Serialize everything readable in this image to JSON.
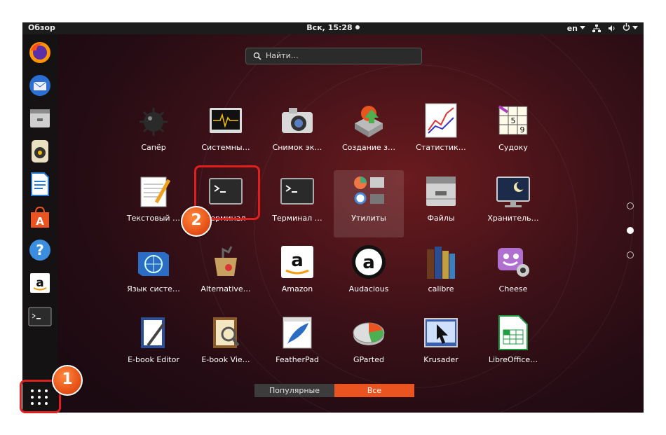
{
  "topbar": {
    "activities": "Обзор",
    "clock": "Вск, 15:28",
    "lang": "en"
  },
  "search": {
    "placeholder": "Найти…"
  },
  "dock": [
    "firefox-icon",
    "thunderbird-icon",
    "files-icon",
    "rhythmbox-icon",
    "writer-icon",
    "software-icon",
    "help-icon",
    "amazon-icon",
    "terminal-icon"
  ],
  "dock_button": "show-applications-icon",
  "apps": [
    {
      "label": "Сапёр",
      "icon": "mines-icon"
    },
    {
      "label": "Системны…",
      "icon": "system-monitor-icon"
    },
    {
      "label": "Снимок эк…",
      "icon": "camera-icon"
    },
    {
      "label": "Создание з…",
      "icon": "startup-disk-icon"
    },
    {
      "label": "Статистик…",
      "icon": "statistics-icon"
    },
    {
      "label": "Судоку",
      "icon": "sudoku-icon"
    },
    {
      "label": "Текстовый …",
      "icon": "text-editor-icon"
    },
    {
      "label": "Терминал",
      "icon": "terminal-icon"
    },
    {
      "label": "Терминал …",
      "icon": "terminal-icon"
    },
    {
      "label": "Утилиты",
      "icon": "utilities-folder-icon"
    },
    {
      "label": "Файлы",
      "icon": "files-icon"
    },
    {
      "label": "Хранитель…",
      "icon": "screensaver-icon"
    },
    {
      "label": "Язык систе…",
      "icon": "language-icon"
    },
    {
      "label": "Alternative…",
      "icon": "alternatives-icon"
    },
    {
      "label": "Amazon",
      "icon": "amazon-icon"
    },
    {
      "label": "Audacious",
      "icon": "audacious-icon"
    },
    {
      "label": "calibre",
      "icon": "calibre-icon"
    },
    {
      "label": "Cheese",
      "icon": "cheese-icon"
    },
    {
      "label": "E-book Editor",
      "icon": "ebook-editor-icon"
    },
    {
      "label": "E-book Vie…",
      "icon": "ebook-viewer-icon"
    },
    {
      "label": "FeatherPad",
      "icon": "featherpad-icon"
    },
    {
      "label": "GParted",
      "icon": "gparted-icon"
    },
    {
      "label": "Krusader",
      "icon": "krusader-icon"
    },
    {
      "label": "LibreOffice…",
      "icon": "libreoffice-calc-icon"
    }
  ],
  "tabs": {
    "popular": "Популярные",
    "all": "Все"
  },
  "annotations": {
    "step1": "1",
    "step2": "2"
  },
  "colors": {
    "accent": "#e95420",
    "highlight": "#e0201e"
  }
}
